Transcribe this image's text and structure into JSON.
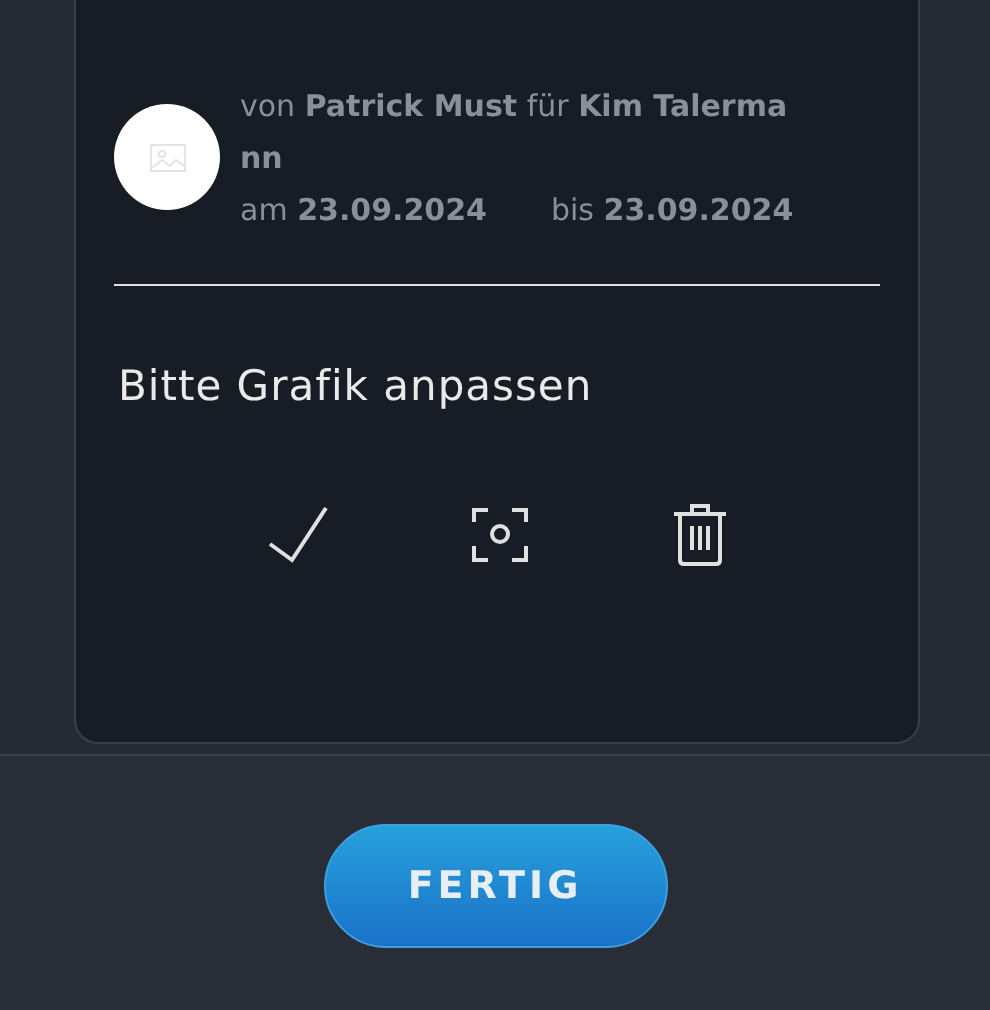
{
  "task": {
    "parties": "von **Patrick Must**  für **Kim Talermann**",
    "dates": [
      {
        "text": "am **23.09.2024**"
      },
      {
        "text": "bis **23.09.2024**"
      }
    ],
    "description": "Bitte Grafik anpassen",
    "actions": [
      {
        "kind": "check"
      },
      {
        "kind": "screenshot"
      },
      {
        "kind": "delete"
      }
    ]
  },
  "footer": {
    "button": "FERTIG"
  }
}
